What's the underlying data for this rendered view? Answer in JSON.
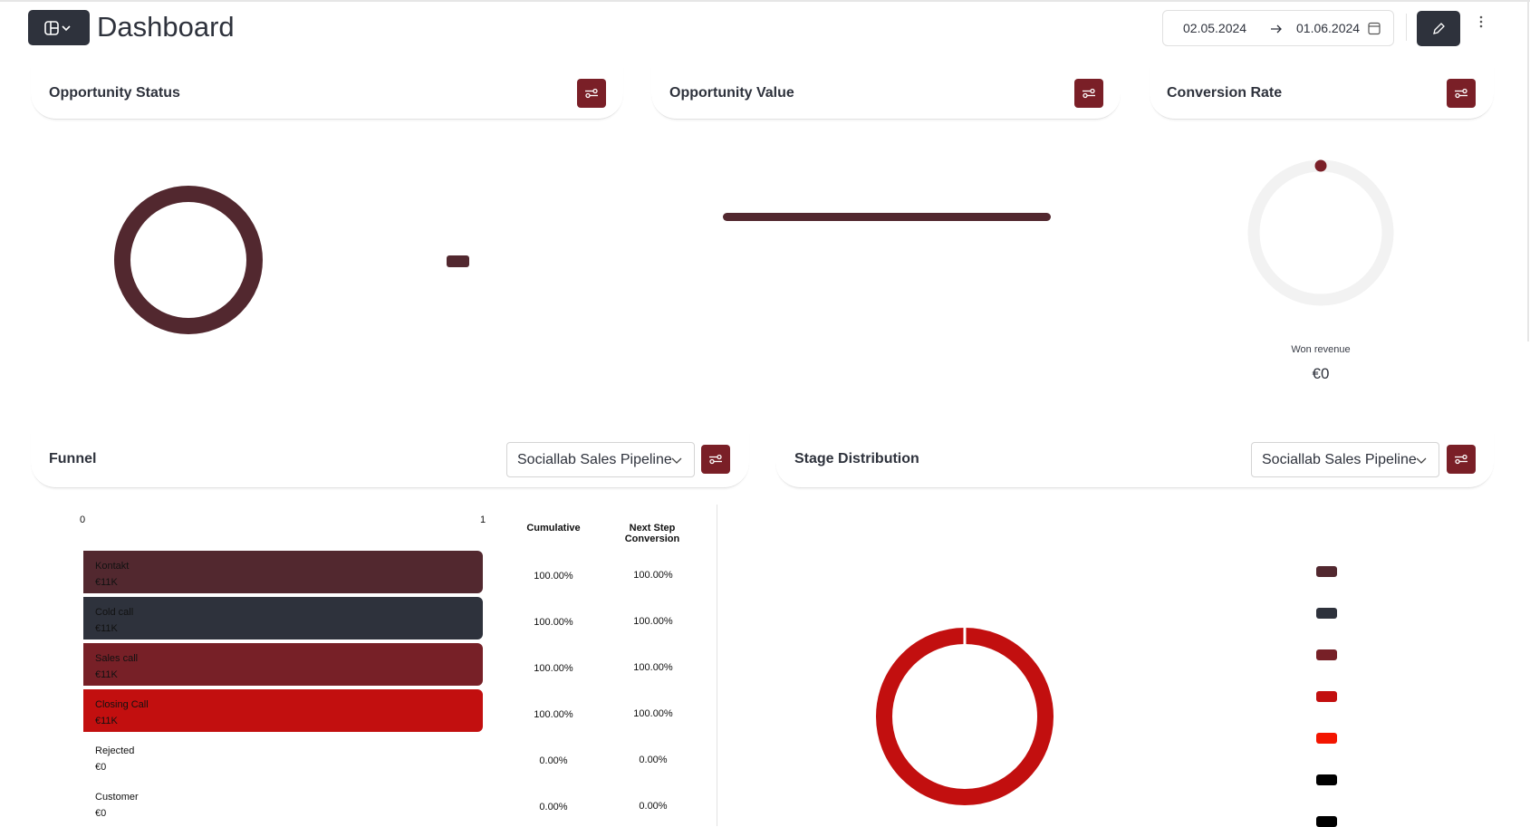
{
  "header": {
    "title": "Dashboard",
    "layout_icon": "layout-icon",
    "date_from": "02.05.2024",
    "date_to": "01.06.2024",
    "arrow_icon": "arrow-right-icon",
    "calendar_icon": "calendar-icon",
    "edit_icon": "pencil-icon",
    "more_icon": "kebab-icon"
  },
  "cards": {
    "opportunity_status": {
      "title": "Opportunity Status"
    },
    "opportunity_value": {
      "title": "Opportunity Value"
    },
    "conversion_rate": {
      "title": "Conversion Rate",
      "label": "Won revenue",
      "value": "€0",
      "progress": 0
    },
    "funnel": {
      "title": "Funnel",
      "pipeline": "Sociallab Sales Pipeline",
      "axis_min": "0",
      "axis_max": "1",
      "col_cumulative": "Cumulative",
      "col_next": "Next Step Conversion",
      "rows": [
        {
          "stage": "Kontakt",
          "value": "€11K",
          "cumulative": "100.00%",
          "next": "100.00%",
          "fraction": 1,
          "color": "#52282f"
        },
        {
          "stage": "Cold call",
          "value": "€11K",
          "cumulative": "100.00%",
          "next": "100.00%",
          "fraction": 1,
          "color": "#2e323c"
        },
        {
          "stage": "Sales call",
          "value": "€11K",
          "cumulative": "100.00%",
          "next": "100.00%",
          "fraction": 1,
          "color": "#772027"
        },
        {
          "stage": "Closing Call",
          "value": "€11K",
          "cumulative": "100.00%",
          "next": "100.00%",
          "fraction": 1,
          "color": "#c20f0f"
        },
        {
          "stage": "Rejected",
          "value": "€0",
          "cumulative": "0.00%",
          "next": "0.00%",
          "fraction": 0,
          "color": "#f31500"
        },
        {
          "stage": "Customer",
          "value": "€0",
          "cumulative": "0.00%",
          "next": "0.00%",
          "fraction": 0,
          "color": "#000000"
        }
      ]
    },
    "stage_distribution": {
      "title": "Stage Distribution",
      "pipeline": "Sociallab Sales Pipeline",
      "legend_colors": [
        "#52282f",
        "#2e323c",
        "#772027",
        "#c20f0f",
        "#f31500",
        "#000000",
        "#000000"
      ]
    }
  },
  "colors": {
    "accent": "#7a1f27",
    "dark": "#2e323c",
    "status_donut": "#52282f",
    "stage_donut": "#c20f0f"
  }
}
